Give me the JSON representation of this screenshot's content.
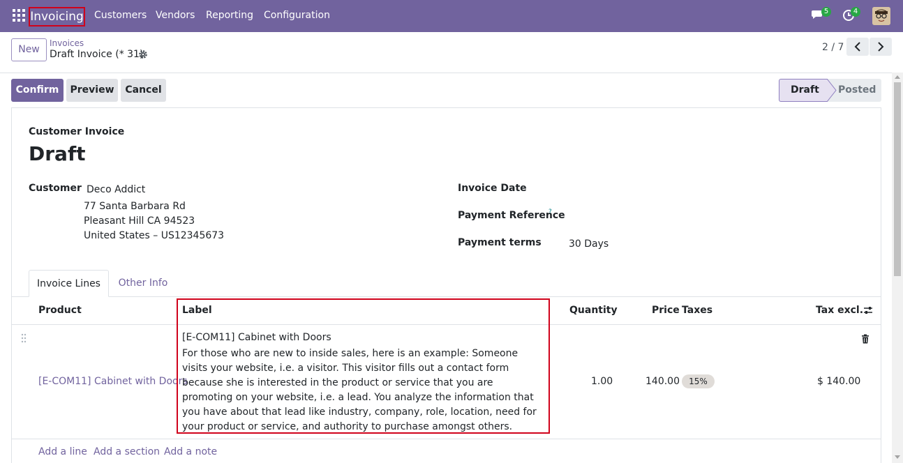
{
  "nav": {
    "app_name": "Invoicing",
    "menu": [
      "Customers",
      "Vendors",
      "Reporting",
      "Configuration"
    ],
    "messages_count": "5",
    "activities_count": "4"
  },
  "control_panel": {
    "new_label": "New",
    "breadcrumb_parent": "Invoices",
    "breadcrumb_current": "Draft Invoice (* 31)",
    "pager": "2 / 7"
  },
  "actions": {
    "confirm": "Confirm",
    "preview": "Preview",
    "cancel": "Cancel"
  },
  "statusbar": {
    "stages": [
      "Draft",
      "Posted"
    ],
    "current": "Draft"
  },
  "form": {
    "move_type": "Customer Invoice",
    "name": "Draft",
    "customer_label": "Customer",
    "customer_name": "Deco Addict",
    "address_line1": "77 Santa Barbara Rd",
    "address_line2": "Pleasant Hill CA 94523",
    "address_line3": "United States – US12345673",
    "invoice_date_label": "Invoice Date",
    "payment_reference_label": "Payment Reference",
    "help_mark": "?",
    "payment_terms_label": "Payment terms",
    "payment_terms_value": "30 Days"
  },
  "tabs": [
    "Invoice Lines",
    "Other Info"
  ],
  "lines": {
    "headers": {
      "product": "Product",
      "label": "Label",
      "quantity": "Quantity",
      "price": "Price",
      "taxes": "Taxes",
      "subtotal": "Tax excl."
    },
    "rows": [
      {
        "product": "[E-COM11] Cabinet with Doors",
        "label_title": "[E-COM11] Cabinet with Doors",
        "label_desc": "For those who are new to inside sales, here is an example: Someone visits your website, i.e. a visitor. This visitor fills out a contact form because she is interested in the product or service that you are promoting on your website, i.e. a lead. You analyze the information that you have about that lead like industry, company, role, location, need for your product or service, and authority to purchase amongst others.",
        "quantity": "1.00",
        "price": "140.00",
        "tax": "15%",
        "subtotal": "$ 140.00"
      }
    ],
    "add_line": "Add a line",
    "add_section": "Add a section",
    "add_note": "Add a note"
  },
  "colors": {
    "brand": "#71639e",
    "highlight": "#d0021b",
    "badge": "#28a745"
  }
}
